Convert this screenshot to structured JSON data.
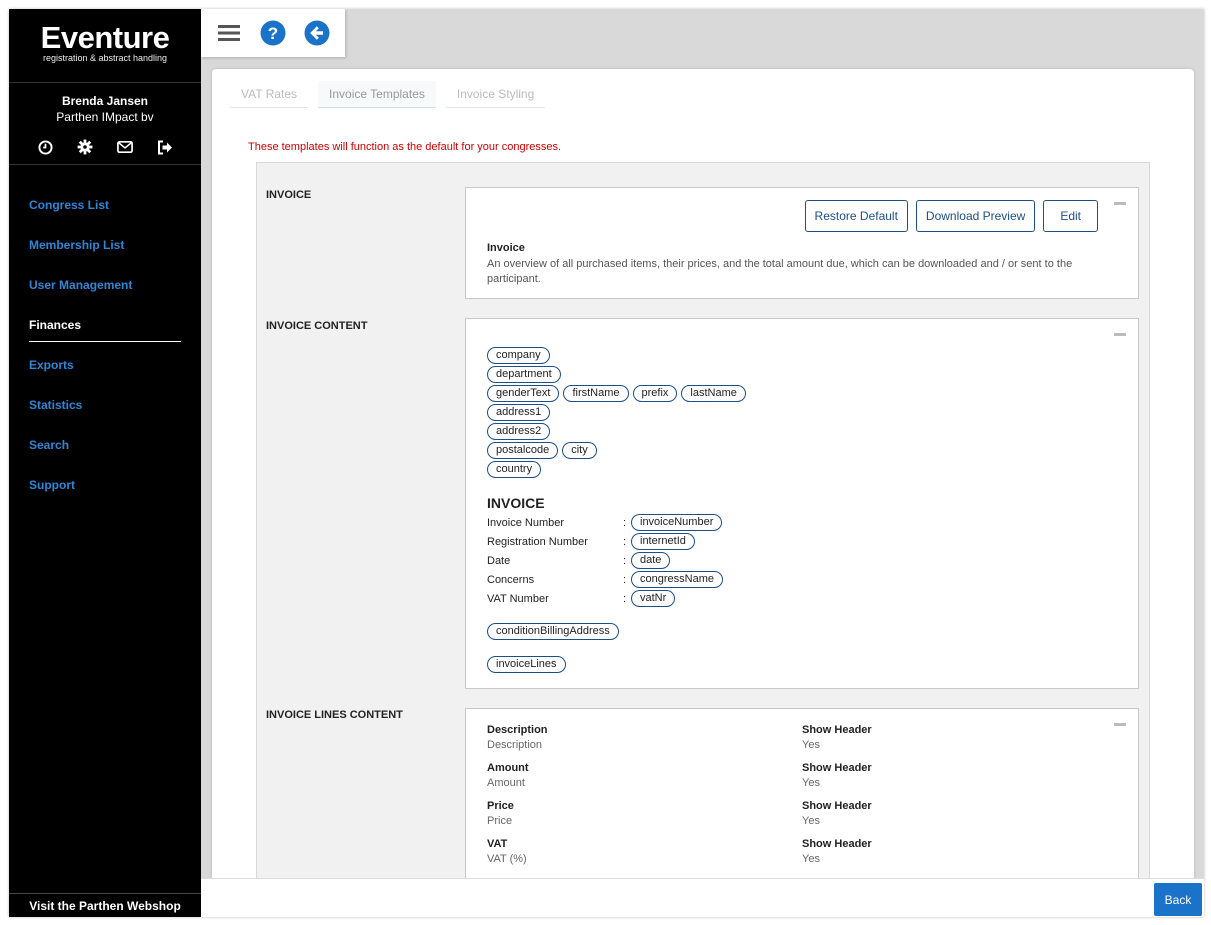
{
  "app": {
    "logo_title": "Eventure",
    "logo_subtitle": "registration & abstract handling"
  },
  "user": {
    "name": "Brenda Jansen",
    "organization": "Parthen IMpact bv",
    "icons": [
      "clock-icon",
      "gear-icon",
      "mail-icon",
      "logout-icon"
    ]
  },
  "nav": {
    "items": [
      {
        "label": "Congress List",
        "active": false
      },
      {
        "label": "Membership List",
        "active": false
      },
      {
        "label": "User Management",
        "active": false
      },
      {
        "label": "Finances",
        "active": true
      },
      {
        "label": "Exports",
        "active": false
      },
      {
        "label": "Statistics",
        "active": false
      },
      {
        "label": "Search",
        "active": false
      },
      {
        "label": "Support",
        "active": false
      }
    ],
    "webshop_label": "Visit the Parthen Webshop"
  },
  "toolbar": {
    "icons": [
      "hamburger-icon",
      "help-icon",
      "back-arrow-icon"
    ]
  },
  "tabs": [
    {
      "label": "VAT Rates",
      "active": false
    },
    {
      "label": "Invoice Templates",
      "active": true
    },
    {
      "label": "Invoice Styling",
      "active": false
    }
  ],
  "notice": "These templates will function as the default for your congresses.",
  "sections": {
    "invoice": {
      "label": "INVOICE",
      "buttons": {
        "restore": "Restore Default",
        "download": "Download Preview",
        "edit": "Edit"
      },
      "title": "Invoice",
      "description": "An overview of all purchased items, their prices, and the total amount due, which can be downloaded and / or sent to the participant."
    },
    "content": {
      "label": "INVOICE CONTENT",
      "address_rows": [
        [
          "company"
        ],
        [
          "department"
        ],
        [
          "genderText",
          "firstName",
          "prefix",
          "lastName"
        ],
        [
          "address1"
        ],
        [
          "address2"
        ],
        [
          "postalcode",
          "city"
        ],
        [
          "country"
        ]
      ],
      "heading": "INVOICE",
      "fields": [
        {
          "label": "Invoice Number",
          "sep": ":",
          "chip": "invoiceNumber"
        },
        {
          "label": "Registration Number",
          "sep": ":",
          "chip": "internetId"
        },
        {
          "label": "Date",
          "sep": ":",
          "chip": "date"
        },
        {
          "label": "Concerns",
          "sep": ":",
          "chip": "congressName"
        },
        {
          "label": "VAT Number",
          "sep": ":",
          "chip": "vatNr"
        }
      ],
      "billing_chip": "conditionBillingAddress",
      "lines_chip": "invoiceLines"
    },
    "lines": {
      "label": "INVOICE LINES CONTENT",
      "items": [
        {
          "title": "Description",
          "value": "Description"
        },
        {
          "title": "Show Header",
          "value": "Yes"
        },
        {
          "title": "Amount",
          "value": "Amount"
        },
        {
          "title": "Show Header",
          "value": "Yes"
        },
        {
          "title": "Price",
          "value": "Price"
        },
        {
          "title": "Show Header",
          "value": "Yes"
        },
        {
          "title": "VAT",
          "value": "VAT (%)"
        },
        {
          "title": "Show Header",
          "value": "Yes"
        }
      ]
    }
  },
  "footer": {
    "back_label": "Back"
  },
  "colors": {
    "accent": "#1a73c8",
    "nav_link": "#2e86d6",
    "notice": "#cc0000",
    "chip_border": "#1d4e89"
  }
}
